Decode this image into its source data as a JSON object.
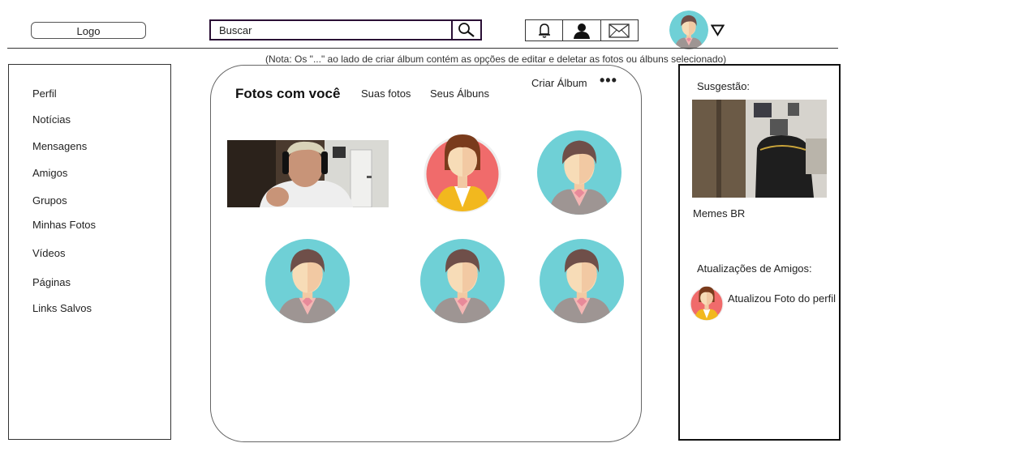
{
  "header": {
    "logo": "Logo",
    "search": {
      "placeholder": "Buscar"
    },
    "icons": [
      "bell-icon",
      "user-icon",
      "mail-icon",
      "search-icon",
      "caret-down-icon"
    ]
  },
  "note": "(Nota: Os \"...\" ao lado de criar álbum contém as opções de editar e deletar as fotos ou álbuns selecionado)",
  "sidebar": {
    "items": [
      {
        "label": "Perfil"
      },
      {
        "label": "Notícias"
      },
      {
        "label": "Mensagens"
      },
      {
        "label": "Amigos"
      },
      {
        "label": "Grupos"
      },
      {
        "label": "Minhas Fotos"
      },
      {
        "label": "Vídeos"
      },
      {
        "label": "Páginas"
      },
      {
        "label": "Links Salvos"
      }
    ]
  },
  "main": {
    "title": "Fotos com você",
    "tabs": [
      {
        "label": "Suas fotos"
      },
      {
        "label": "Seus Álbuns"
      }
    ],
    "create_album": "Criar Álbum",
    "more": "•••"
  },
  "right": {
    "suggestion_heading": "Susgestão:",
    "suggestion_name": "Memes BR",
    "friends_heading": "Atualizações de Amigos:",
    "friend_update": "Atualizou Foto do perfil"
  },
  "colors": {
    "avatar_teal": "#6fd0d6",
    "avatar_red": "#f06b6b",
    "frame_dark": "#2a0f35"
  }
}
